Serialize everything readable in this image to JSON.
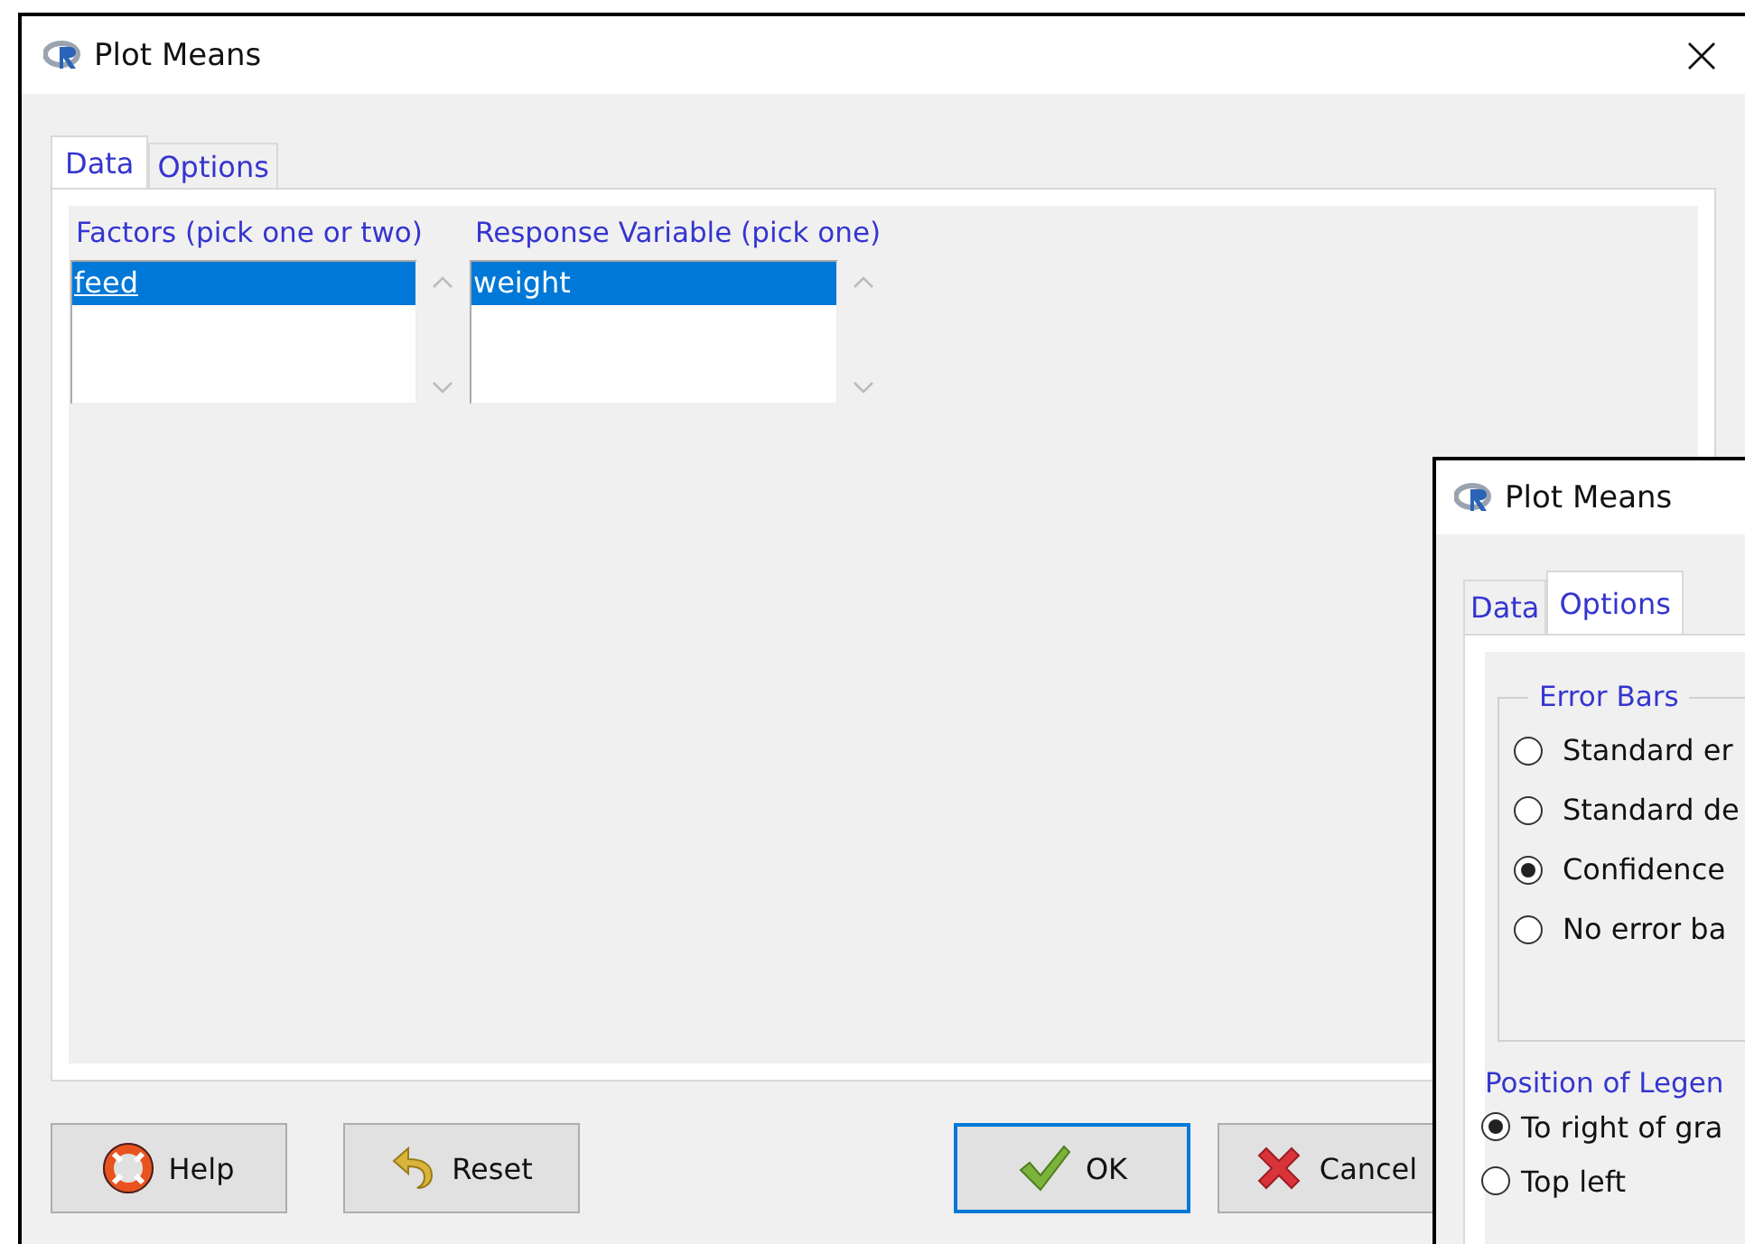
{
  "main_window": {
    "title": "Plot Means",
    "tabs": [
      {
        "label": "Data",
        "selected": true
      },
      {
        "label": "Options",
        "selected": false
      }
    ],
    "lists": [
      {
        "label": "Factors (pick one or two)",
        "items": [
          {
            "text": "feed",
            "selected": true,
            "focused": true
          }
        ]
      },
      {
        "label": "Response Variable (pick one)",
        "items": [
          {
            "text": "weight",
            "selected": true,
            "focused": false
          }
        ]
      }
    ],
    "buttons": [
      {
        "label": "Help",
        "kind": "help",
        "default": false
      },
      {
        "label": "Reset",
        "kind": "reset",
        "default": false
      },
      {
        "label": "OK",
        "kind": "ok",
        "default": true
      },
      {
        "label": "Cancel",
        "kind": "cancel",
        "default": false
      }
    ]
  },
  "options_window": {
    "title": "Plot Means",
    "tabs": [
      {
        "label": "Data",
        "selected": false
      },
      {
        "label": "Options",
        "selected": true
      }
    ],
    "error_bars": {
      "label": "Error Bars",
      "options": [
        {
          "label": "Standard er",
          "selected": false
        },
        {
          "label": "Standard de",
          "selected": false
        },
        {
          "label": "Confidence",
          "selected": true
        },
        {
          "label": "No error ba",
          "selected": false
        }
      ]
    },
    "legend_position": {
      "label": "Position of Legen",
      "options": [
        {
          "label": "To right of gra",
          "selected": true
        },
        {
          "label": "Top left",
          "selected": false
        }
      ]
    }
  }
}
